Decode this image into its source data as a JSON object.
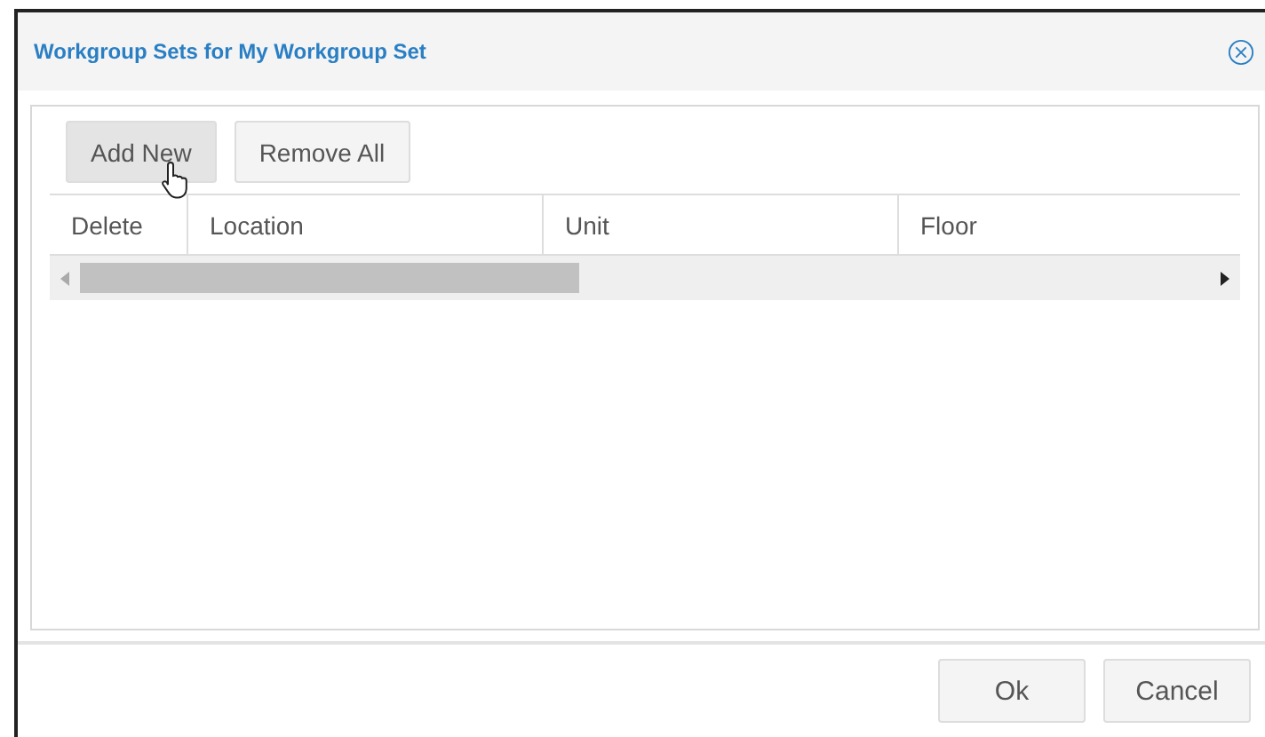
{
  "dialog": {
    "title": "Workgroup Sets for My Workgroup Set"
  },
  "toolbar": [
    {
      "label": "Add New",
      "hovered": true
    },
    {
      "label": "Remove All",
      "hovered": false
    }
  ],
  "table": {
    "columns": [
      "Delete",
      "Location",
      "Unit",
      "Floor"
    ]
  },
  "buttons": [
    "Ok",
    "Cancel"
  ]
}
